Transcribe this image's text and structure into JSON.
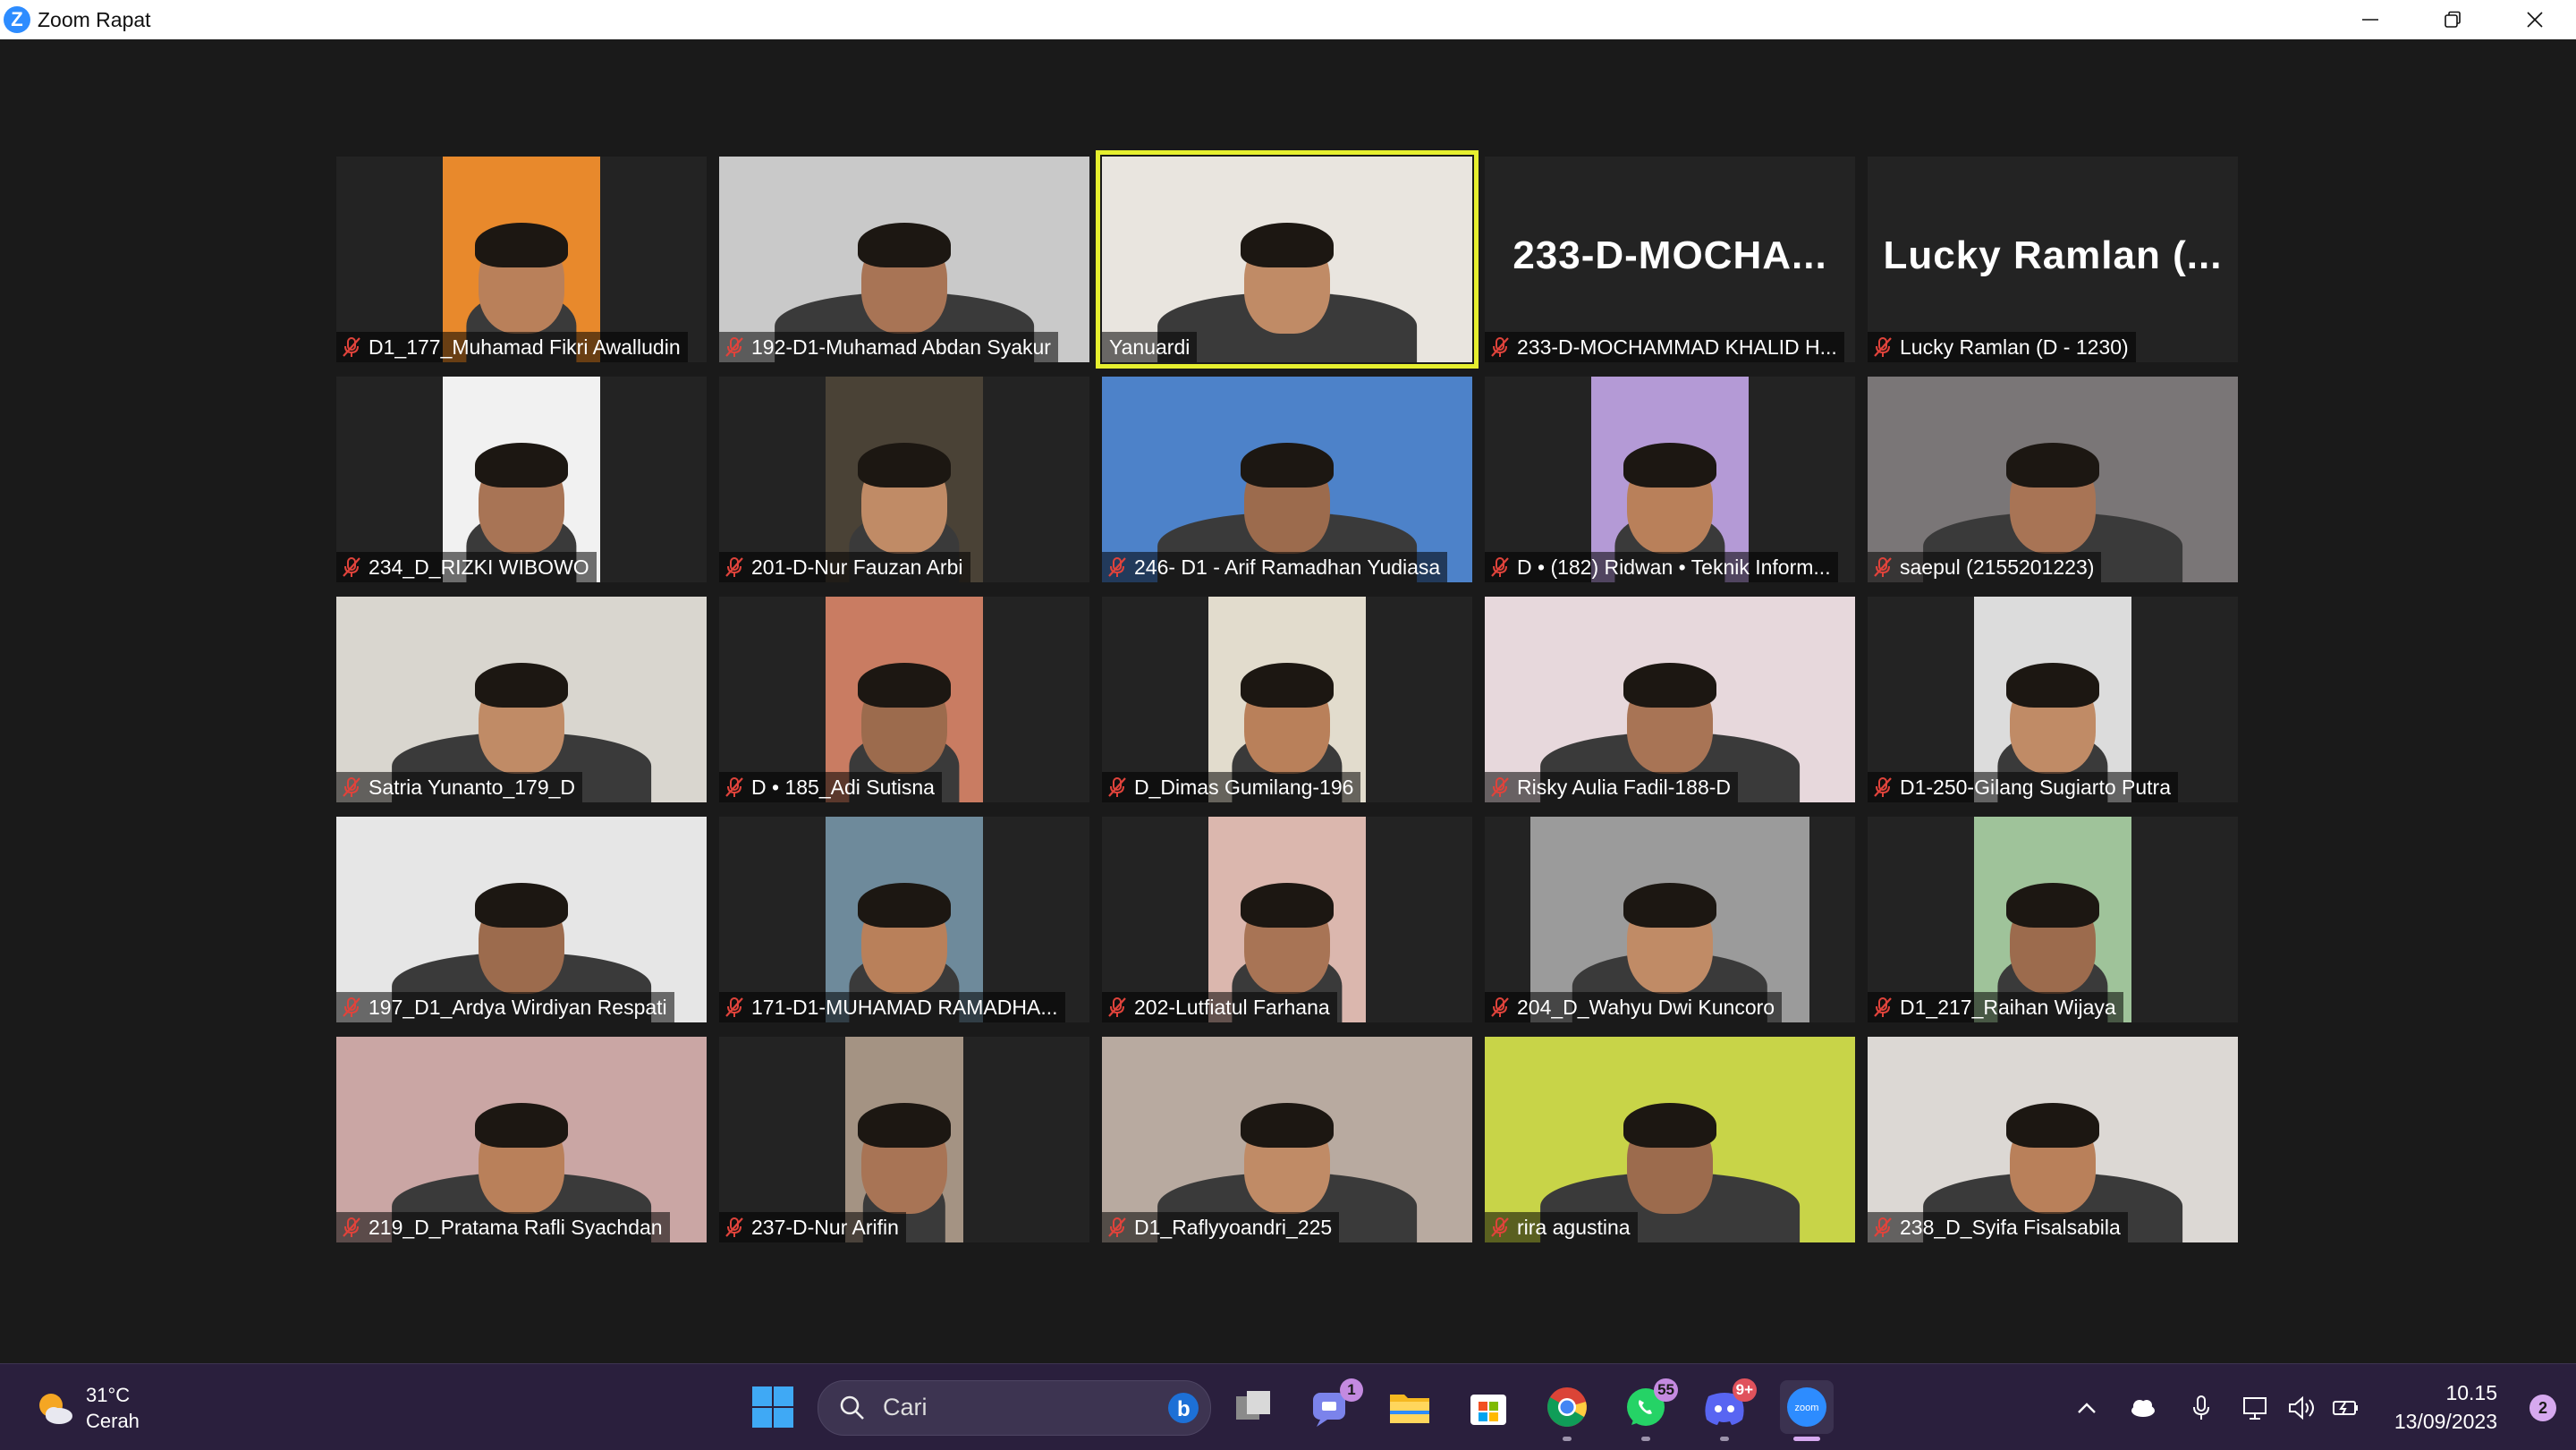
{
  "window": {
    "title": "Zoom Rapat",
    "logo_letter": "Z"
  },
  "participants": [
    {
      "name": "D1_177_Muhamad Fikri Awalludin",
      "muted": true,
      "bg": "#e8892c"
    },
    {
      "name": "192-D1-Muhamad Abdan Syakur",
      "muted": true,
      "bg": "#c9c9c9"
    },
    {
      "name": "Yanuardi",
      "muted": false,
      "active_speaker": true,
      "bg": "#e9e5df"
    },
    {
      "name": "233-D-MOCHAMMAD KHALID H...",
      "display_name": "233-D-MOCHA...",
      "muted": true,
      "video_off": true
    },
    {
      "name": "Lucky Ramlan (D - 1230)",
      "display_name": "Lucky  Ramlan  (...",
      "muted": true,
      "video_off": true
    },
    {
      "name": "234_D_RIZKI WIBOWO",
      "muted": true,
      "bg": "#f1f1f1"
    },
    {
      "name": "201-D-Nur Fauzan Arbi",
      "muted": true,
      "bg": "#4a4236"
    },
    {
      "name": "246- D1 - Arif Ramadhan Yudiasa",
      "muted": true,
      "bg": "#4d82c9"
    },
    {
      "name": "D • (182) Ridwan • Teknik Inform...",
      "muted": true,
      "bg": "#b49ad6"
    },
    {
      "name": "saepul (2155201223)",
      "muted": true,
      "bg": "#7a7677"
    },
    {
      "name": "Satria Yunanto_179_D",
      "muted": true,
      "bg": "#d9d6cf"
    },
    {
      "name": "D • 185_Adi Sutisna",
      "muted": true,
      "bg": "#c97c62"
    },
    {
      "name": "D_Dimas Gumilang-196",
      "muted": true,
      "bg": "#e2dccd"
    },
    {
      "name": "Risky Aulia Fadil-188-D",
      "muted": true,
      "bg": "#e7d8dc"
    },
    {
      "name": "D1-250-Gilang Sugiarto Putra",
      "muted": true,
      "bg": "#dcdcdc"
    },
    {
      "name": "197_D1_Ardya Wirdiyan Respati",
      "muted": true,
      "bg": "#e6e6e6"
    },
    {
      "name": "171-D1-MUHAMAD RAMADHA...",
      "muted": true,
      "bg": "#6e8a9b"
    },
    {
      "name": "202-Lutfiatul Farhana",
      "muted": true,
      "bg": "#dbb7ae"
    },
    {
      "name": "204_D_Wahyu Dwi Kuncoro",
      "muted": true,
      "bg": "#9b9b9b"
    },
    {
      "name": "D1_217_Raihan Wijaya",
      "muted": true,
      "bg": "#9fc39a"
    },
    {
      "name": "219_D_Pratama Rafli Syachdan",
      "muted": true,
      "bg": "#caa6a4"
    },
    {
      "name": "237-D-Nur Arifin",
      "muted": true,
      "bg": "#a49383"
    },
    {
      "name": "D1_Raflyyoandri_225",
      "muted": true,
      "bg": "#b8aaa0"
    },
    {
      "name": "rira agustina",
      "muted": true,
      "bg": "#c8d448"
    },
    {
      "name": "238_D_Syifa Fisalsabila",
      "muted": true,
      "bg": "#dcd8d4"
    }
  ],
  "taskbar": {
    "weather": {
      "temp": "31°C",
      "condition": "Cerah",
      "icon": "partly-sunny-icon"
    },
    "search_placeholder": "Cari",
    "apps": [
      {
        "name": "start-icon"
      },
      {
        "name": "task-view-icon"
      },
      {
        "name": "teams-chat-icon",
        "badge": "1"
      },
      {
        "name": "file-explorer-icon"
      },
      {
        "name": "microsoft-store-icon"
      },
      {
        "name": "chrome-icon"
      },
      {
        "name": "whatsapp-icon",
        "badge": "55"
      },
      {
        "name": "discord-icon",
        "badge": "9+"
      },
      {
        "name": "zoom-icon",
        "label": "zoom"
      }
    ],
    "clock": {
      "time": "10.15",
      "date": "13/09/2023"
    },
    "notifications": "2"
  }
}
